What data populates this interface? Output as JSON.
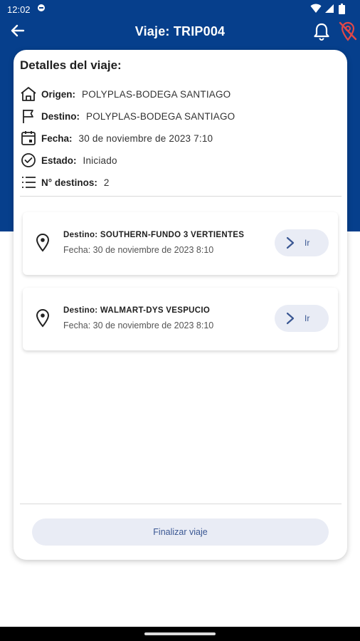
{
  "status_bar": {
    "time": "12:02",
    "icons": [
      "status-circle-icon",
      "wifi-icon",
      "cellular-icon",
      "battery-icon"
    ]
  },
  "app_bar": {
    "title": "Viaje: TRIP004",
    "back_icon": "arrow-back-icon",
    "actions": [
      "bell-icon",
      "location-off-icon"
    ]
  },
  "trip_details": {
    "heading": "Detalles del viaje:",
    "rows": [
      {
        "icon": "house-icon",
        "label": "Origen:",
        "value": "POLYPLAS-BODEGA SANTIAGO"
      },
      {
        "icon": "flag-icon",
        "label": "Destino:",
        "value": "POLYPLAS-BODEGA SANTIAGO"
      },
      {
        "icon": "calendar-icon",
        "label": "Fecha:",
        "value": "30 de noviembre de 2023 7:10"
      },
      {
        "icon": "check-circle-icon",
        "label": "Estado:",
        "value": "Iniciado"
      },
      {
        "icon": "numbered-list-icon",
        "label": "N° destinos:",
        "value": "2"
      }
    ]
  },
  "destinations": [
    {
      "label": "Destino:",
      "name": "SOUTHERN-FUNDO 3 VERTIENTES",
      "date_text": "Fecha: 30 de noviembre de 2023 8:10",
      "button_label": "Ir"
    },
    {
      "label": "Destino:",
      "name": "WALMART-DYS VESPUCIO",
      "date_text": "Fecha: 30 de noviembre de 2023 8:10",
      "button_label": "Ir"
    }
  ],
  "finish_button_label": "Finalizar viaje",
  "colors": {
    "header": "#063f8c",
    "button_bg": "#e9ecf5",
    "button_text": "#3a5793",
    "alert_icon": "#e04848"
  }
}
